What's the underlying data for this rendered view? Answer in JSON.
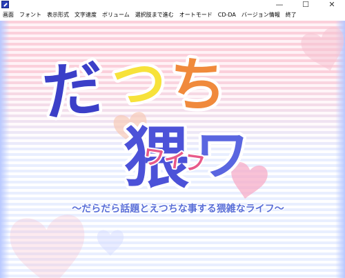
{
  "window": {
    "minimize_glyph": "—",
    "maximize_glyph": "☐",
    "close_glyph": "✕"
  },
  "menu": {
    "items": [
      "画面",
      "フォント",
      "表示形式",
      "文字速度",
      "ボリューム",
      "選択肢まで進む",
      "オートモード",
      "CD-DA",
      "バージョン情報",
      "終了"
    ]
  },
  "title_screen": {
    "logo_line1": [
      "だ",
      "つ",
      "ち"
    ],
    "logo_line2": [
      "猥",
      "ワ"
    ],
    "logo_ruby": "ワイフ",
    "subtitle": "〜だらだら話題とえつちな事する猥雑なライフ〜"
  },
  "colors": {
    "blue_dark": "#3b3fc8",
    "yellow": "#f7e23a",
    "orange": "#f08a3c",
    "pink": "#e85a8a",
    "outline": "#ffffff",
    "stripe_pink": "#fbd0db",
    "stripe_blue": "#e9efff"
  }
}
